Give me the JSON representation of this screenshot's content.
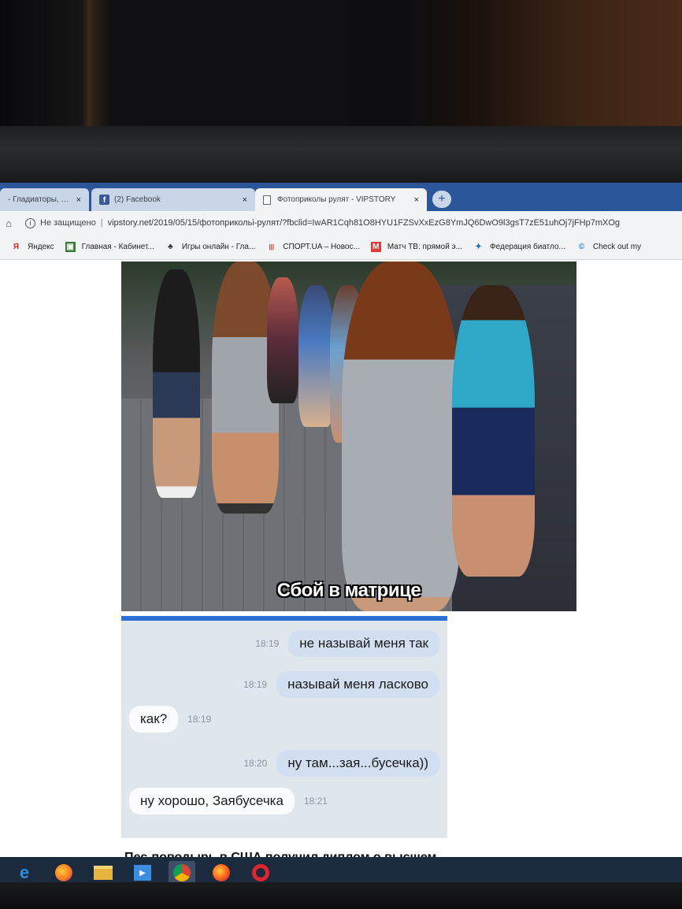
{
  "tabs": [
    {
      "title": "- Гладиаторы, игр",
      "close": "×"
    },
    {
      "title": "(2) Facebook",
      "close": "×",
      "icon": "facebook-icon"
    },
    {
      "title": "Фотоприколы рулят - VIPSTORY",
      "close": "×",
      "icon": "document-icon"
    }
  ],
  "new_tab": "+",
  "address": {
    "security_label": "Не защищено",
    "divider": "|",
    "url": "vipstory.net/2019/05/15/фотоприкольi-рулят/?fbclid=IwAR1Cqh81O8HYU1FZSvXxEzG8YmJQ6DwO9l3gsT7zE51uhOj7jFHp7mXOg"
  },
  "bookmarks": [
    {
      "label": "Яндекс",
      "icon": "yandex-icon",
      "color": "#e02020"
    },
    {
      "label": "Главная - Кабинет...",
      "icon": "cabinet-icon",
      "color": "#2e7d32"
    },
    {
      "label": "Игры онлайн - Гла...",
      "icon": "games-icon",
      "color": "#333333"
    },
    {
      "label": "СПОРТ.UA – Новос...",
      "icon": "sport-icon",
      "color": "#c0392b"
    },
    {
      "label": "Матч ТВ: прямой э...",
      "icon": "match-tv-icon",
      "color": "#e53935"
    },
    {
      "label": "Федерация биатло...",
      "icon": "biathlon-icon",
      "color": "#1565c0"
    },
    {
      "label": "Check out my",
      "icon": "check-icon",
      "color": "#1e88e5"
    }
  ],
  "photo": {
    "caption": "Сбой в матрице"
  },
  "chat": {
    "messages": [
      {
        "direction": "out",
        "time": "18:19",
        "text": "не называй меня так"
      },
      {
        "direction": "out",
        "time": "18:19",
        "text": "называй меня ласково"
      },
      {
        "direction": "in",
        "time": "18:19",
        "text": "как?"
      },
      {
        "direction": "out",
        "time": "18:20",
        "text": "ну там...зая...бусечка))"
      },
      {
        "direction": "in",
        "time": "18:21",
        "text": "ну хорошо, Заябусечка"
      }
    ]
  },
  "headline": "Пес-поводырь в США получил диплом о высшем",
  "colors": {
    "tabbar": "#2b579a",
    "chat_header": "#2d6fd4",
    "taskbar": "#1c2a3e"
  },
  "taskbar": [
    {
      "icon": "edge-icon"
    },
    {
      "icon": "firefox-icon"
    },
    {
      "icon": "file-explorer-icon"
    },
    {
      "icon": "media-player-icon"
    },
    {
      "icon": "chrome-icon"
    },
    {
      "icon": "firefox-alt-icon"
    },
    {
      "icon": "opera-icon"
    }
  ]
}
